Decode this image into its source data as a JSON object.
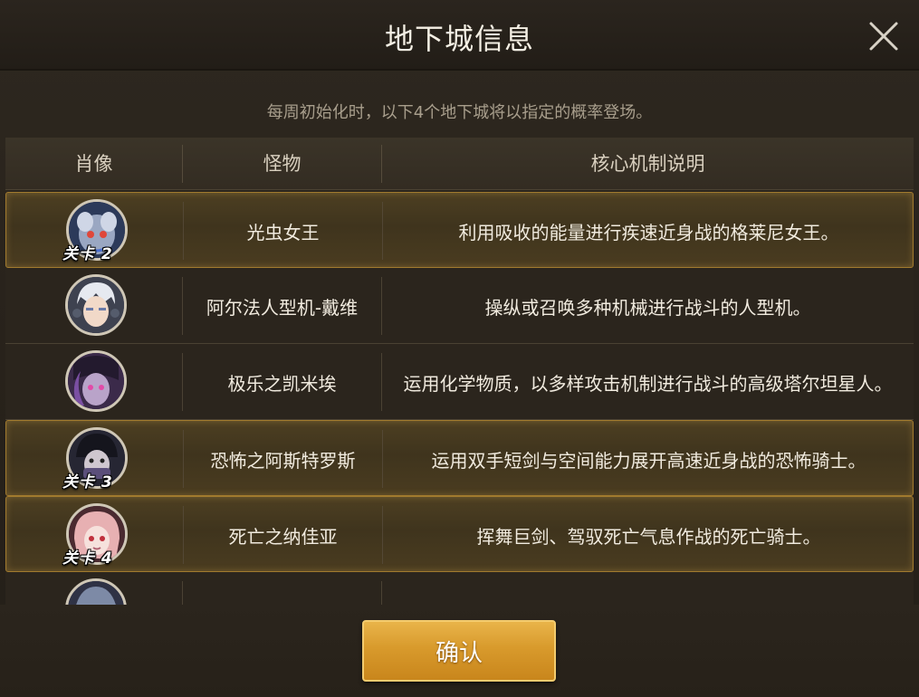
{
  "dialog": {
    "title": "地下城信息",
    "subtitle": "每周初始化时，以下4个地下城将以指定的概率登场。",
    "confirm_label": "确认"
  },
  "table": {
    "headers": [
      "肖像",
      "怪物",
      "核心机制说明"
    ],
    "rows": [
      {
        "stage_badge": "关卡 2",
        "monster": "光虫女王",
        "description": "利用吸收的能量进行疾速近身战的格莱尼女王。",
        "highlighted": true
      },
      {
        "stage_badge": "",
        "monster": "阿尔法人型机-戴维",
        "description": "操纵或召唤多种机械进行战斗的人型机。",
        "highlighted": false
      },
      {
        "stage_badge": "",
        "monster": "极乐之凯米埃",
        "description": "运用化学物质，以多样攻击机制进行战斗的高级塔尔坦星人。",
        "highlighted": false
      },
      {
        "stage_badge": "关卡 3",
        "monster": "恐怖之阿斯特罗斯",
        "description": "运用双手短剑与空间能力展开高速近身战的恐怖骑士。",
        "highlighted": true
      },
      {
        "stage_badge": "关卡 4",
        "monster": "死亡之纳佳亚",
        "description": "挥舞巨剑、驾驭死亡气息作战的死亡骑士。",
        "highlighted": true
      }
    ]
  },
  "icons": {
    "close": "close-icon"
  },
  "colors": {
    "accent_gold": "#d89a2c",
    "highlight_border": "#a17a2e"
  }
}
